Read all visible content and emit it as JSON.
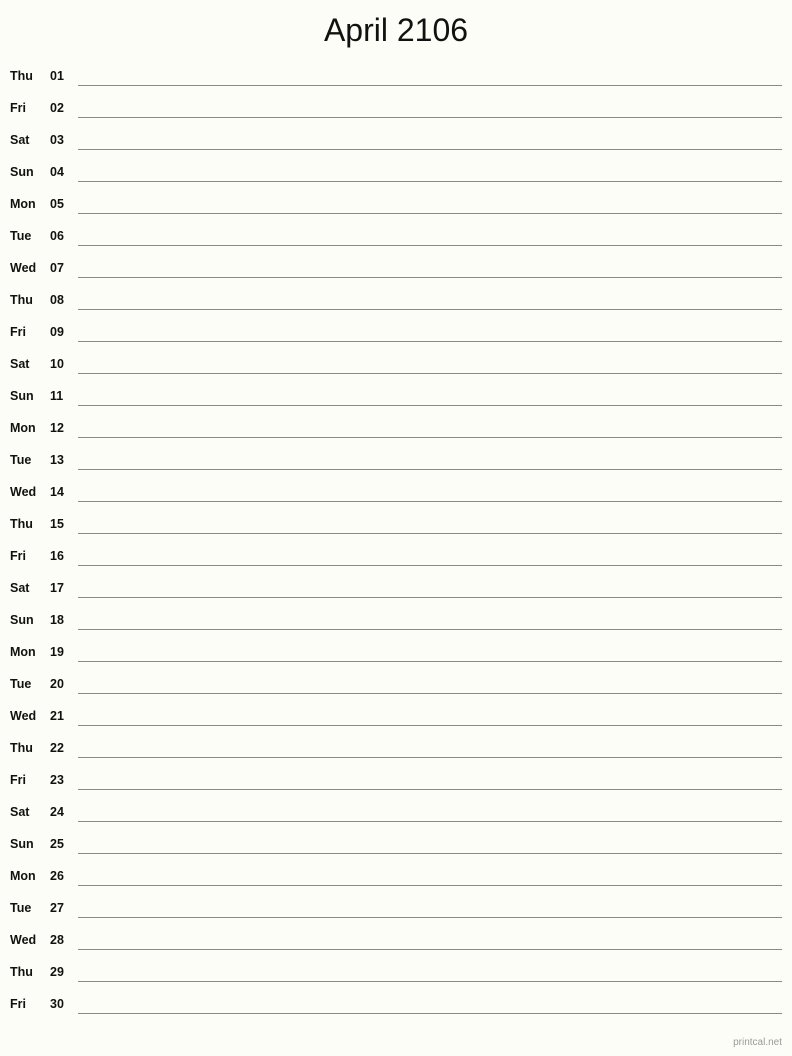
{
  "page": {
    "title": "April 2106",
    "month_name": "April",
    "year": "2106",
    "background_color": "#fdfdf7",
    "line_color": "#8a8a8a",
    "text_color": "#111111"
  },
  "footer": {
    "label": "printcal.net",
    "color": "#9a9a9a"
  },
  "days": [
    {
      "weekday": "Thu",
      "daynum": "01"
    },
    {
      "weekday": "Fri",
      "daynum": "02"
    },
    {
      "weekday": "Sat",
      "daynum": "03"
    },
    {
      "weekday": "Sun",
      "daynum": "04"
    },
    {
      "weekday": "Mon",
      "daynum": "05"
    },
    {
      "weekday": "Tue",
      "daynum": "06"
    },
    {
      "weekday": "Wed",
      "daynum": "07"
    },
    {
      "weekday": "Thu",
      "daynum": "08"
    },
    {
      "weekday": "Fri",
      "daynum": "09"
    },
    {
      "weekday": "Sat",
      "daynum": "10"
    },
    {
      "weekday": "Sun",
      "daynum": "11"
    },
    {
      "weekday": "Mon",
      "daynum": "12"
    },
    {
      "weekday": "Tue",
      "daynum": "13"
    },
    {
      "weekday": "Wed",
      "daynum": "14"
    },
    {
      "weekday": "Thu",
      "daynum": "15"
    },
    {
      "weekday": "Fri",
      "daynum": "16"
    },
    {
      "weekday": "Sat",
      "daynum": "17"
    },
    {
      "weekday": "Sun",
      "daynum": "18"
    },
    {
      "weekday": "Mon",
      "daynum": "19"
    },
    {
      "weekday": "Tue",
      "daynum": "20"
    },
    {
      "weekday": "Wed",
      "daynum": "21"
    },
    {
      "weekday": "Thu",
      "daynum": "22"
    },
    {
      "weekday": "Fri",
      "daynum": "23"
    },
    {
      "weekday": "Sat",
      "daynum": "24"
    },
    {
      "weekday": "Sun",
      "daynum": "25"
    },
    {
      "weekday": "Mon",
      "daynum": "26"
    },
    {
      "weekday": "Tue",
      "daynum": "27"
    },
    {
      "weekday": "Wed",
      "daynum": "28"
    },
    {
      "weekday": "Thu",
      "daynum": "29"
    },
    {
      "weekday": "Fri",
      "daynum": "30"
    }
  ]
}
